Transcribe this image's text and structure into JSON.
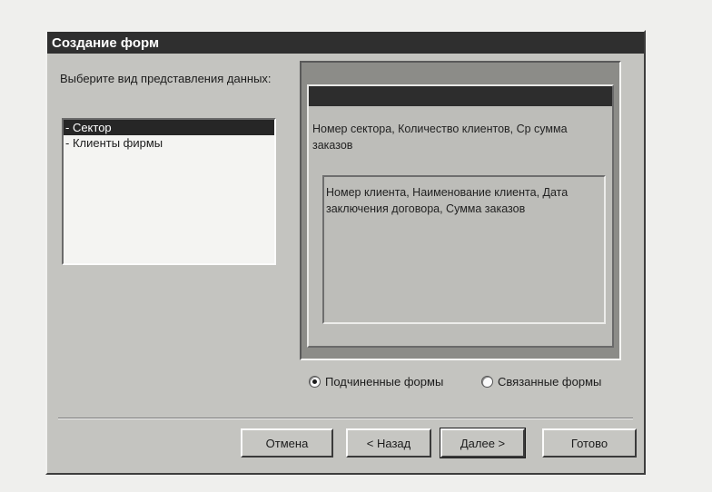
{
  "window": {
    "title": "Создание форм"
  },
  "prompt": "Выберите вид представления данных:",
  "views": [
    {
      "label": "- Сектор",
      "selected": true
    },
    {
      "label": "- Клиенты фирмы",
      "selected": false
    }
  ],
  "preview": {
    "main_fields": "Номер сектора, Количество клиентов, Ср сумма заказов",
    "subform_fields": "Номер клиента, Наименование клиента, Дата заключения договора, Сумма заказов"
  },
  "options": [
    {
      "label": "Подчиненные формы",
      "checked": true
    },
    {
      "label": "Связанные формы",
      "checked": false
    }
  ],
  "buttons": {
    "cancel": "Отмена",
    "back": "< Назад",
    "next": "Далее >",
    "finish": "Готово"
  }
}
